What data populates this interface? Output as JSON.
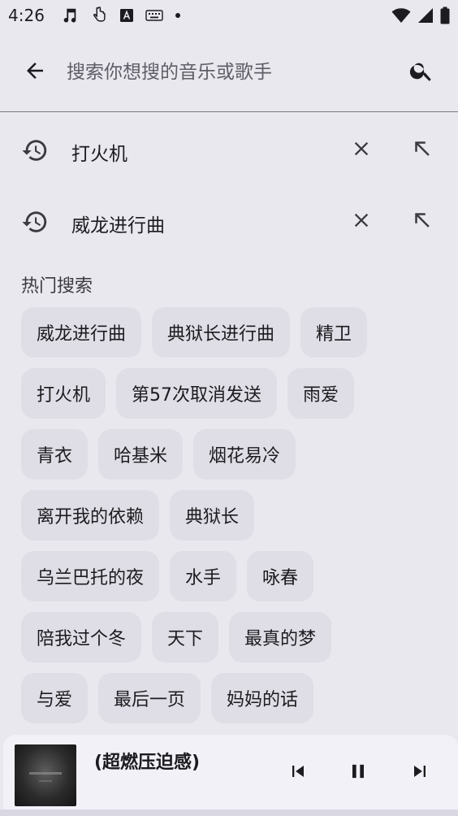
{
  "status_bar": {
    "time": "4:26",
    "left_icons": [
      "music-note-icon",
      "touch-hand-icon",
      "text-a-icon",
      "keyboard-icon",
      "dot-icon"
    ],
    "right_icons": [
      "wifi-icon",
      "signal-icon",
      "battery-icon"
    ]
  },
  "search": {
    "placeholder": "搜索你想搜的音乐或歌手",
    "back_icon": "arrow-left-icon",
    "search_icon": "search-icon"
  },
  "history": [
    {
      "text": "打火机"
    },
    {
      "text": "威龙进行曲"
    }
  ],
  "hot_search": {
    "title": "热门搜索",
    "rows": [
      [
        "威龙进行曲",
        "典狱长进行曲",
        "精卫"
      ],
      [
        "打火机",
        "第57次取消发送",
        "雨爱"
      ],
      [
        "青衣",
        "哈基米",
        "烟花易冷"
      ],
      [
        "离开我的依赖",
        "典狱长"
      ],
      [
        "乌兰巴托的夜",
        "水手",
        "咏春"
      ],
      [
        "陪我过个冬",
        "天下",
        "最真的梦"
      ],
      [
        "与爱",
        "最后一页",
        "妈妈的话"
      ]
    ]
  },
  "player": {
    "title": "(超燃压迫感)",
    "controls": [
      "skip-previous-icon",
      "pause-icon",
      "skip-next-icon"
    ]
  },
  "colors": {
    "background": "#e9e8ef",
    "chip": "#dfdee6",
    "player": "#f2f1f7"
  }
}
